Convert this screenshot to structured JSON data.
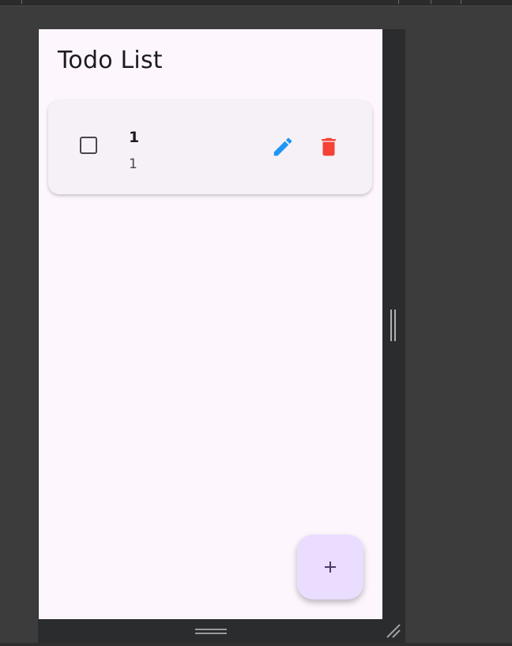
{
  "app": {
    "title": "Todo List"
  },
  "todos": [
    {
      "title": "1",
      "description": "1",
      "completed": false
    }
  ],
  "icons": {
    "checkbox": "checkbox-unchecked-icon",
    "edit": "pencil-icon",
    "delete": "trash-icon",
    "add": "plus-icon"
  },
  "colors": {
    "background": "#fdf6fd",
    "card": "#f6f1f7",
    "edit": "#2196f3",
    "delete": "#f44336",
    "fab": "#eaddff",
    "fab_icon": "#4a3a6a",
    "text": "#1d1b20"
  }
}
